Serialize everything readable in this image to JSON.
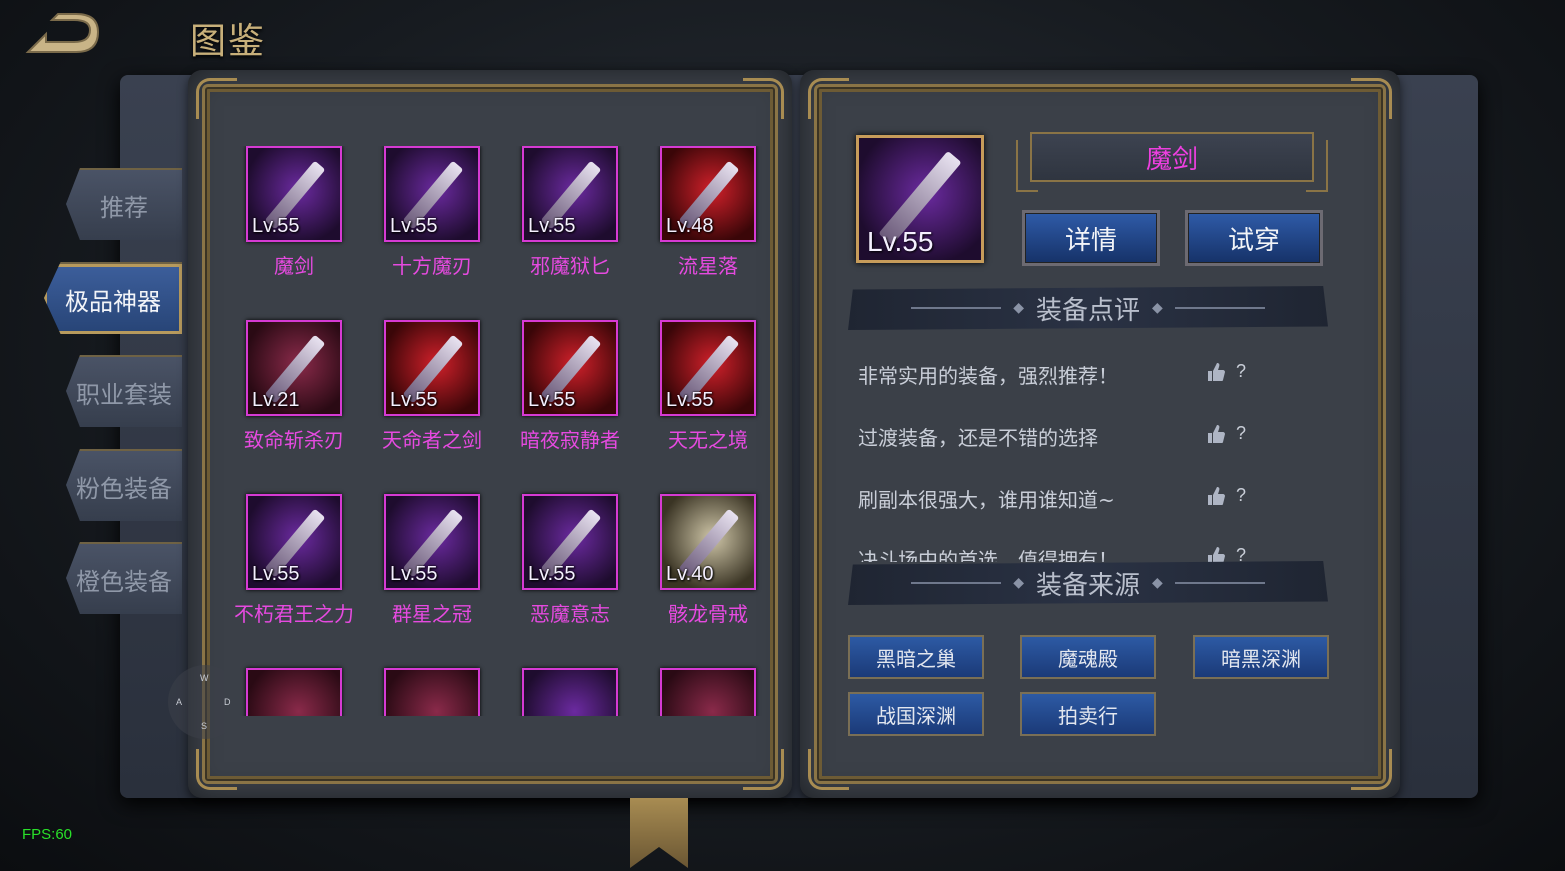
{
  "header": {
    "title": "图鉴"
  },
  "tabs": [
    {
      "label": "推荐",
      "active": false
    },
    {
      "label": "极品神器",
      "active": true
    },
    {
      "label": "职业套装",
      "active": false
    },
    {
      "label": "粉色装备",
      "active": false
    },
    {
      "label": "橙色装备",
      "active": false
    }
  ],
  "items": [
    {
      "name": "魔剑",
      "level": "Lv.55"
    },
    {
      "name": "十方魔刃",
      "level": "Lv.55"
    },
    {
      "name": "邪魔狱匕",
      "level": "Lv.55"
    },
    {
      "name": "流星落",
      "level": "Lv.48"
    },
    {
      "name": "致命斩杀刃",
      "level": "Lv.21"
    },
    {
      "name": "天命者之剑",
      "level": "Lv.55"
    },
    {
      "name": "暗夜寂静者",
      "level": "Lv.55"
    },
    {
      "name": "天无之境",
      "level": "Lv.55"
    },
    {
      "name": "不朽君王之力",
      "level": "Lv.55"
    },
    {
      "name": "群星之冠",
      "level": "Lv.55"
    },
    {
      "name": "恶魔意志",
      "level": "Lv.55"
    },
    {
      "name": "骸龙骨戒",
      "level": "Lv.40"
    },
    {
      "name": "",
      "level": ""
    },
    {
      "name": "",
      "level": ""
    },
    {
      "name": "",
      "level": ""
    },
    {
      "name": "",
      "level": ""
    }
  ],
  "joystick": {
    "up": "W",
    "left": "A",
    "right": "D",
    "down": "S"
  },
  "selected": {
    "name": "魔剑",
    "level": "Lv.55",
    "detail_label": "详情",
    "try_label": "试穿"
  },
  "review_section": {
    "title": "装备点评",
    "reviews": [
      {
        "text": "非常实用的装备，强烈推荐！",
        "count": "?"
      },
      {
        "text": "过渡装备，还是不错的选择",
        "count": "?"
      },
      {
        "text": "刷副本很强大，谁用谁知道~",
        "count": "?"
      },
      {
        "text": "决斗场中的首选，值得拥有！",
        "count": "?"
      }
    ]
  },
  "source_section": {
    "title": "装备来源",
    "sources": [
      "黑暗之巢",
      "魔魂殿",
      "暗黑深渊",
      "战国深渊",
      "拍卖行"
    ]
  },
  "fps": "FPS:60",
  "colors": {
    "item_name": "#e64ae0",
    "rarity_border": "#d63ad3",
    "active_tab": "#274476",
    "fps": "#29e029"
  }
}
